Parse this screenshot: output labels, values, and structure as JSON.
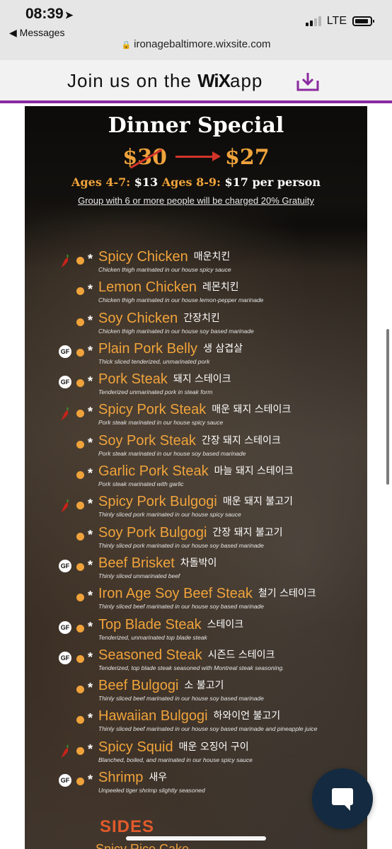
{
  "status_bar": {
    "time": "08:39",
    "location_icon": "location-arrow-icon",
    "back_label": "◀ Messages",
    "network": "LTE"
  },
  "browser": {
    "url": "ironagebaltimore.wixsite.com"
  },
  "wix_banner": {
    "text_before": "Join us on the",
    "logo": "WiX",
    "text_after": "app",
    "accent_color": "#8a29a0"
  },
  "menu": {
    "title": "Dinner Special",
    "old_price": "$30",
    "new_price": "$27",
    "ages_a_label": "Ages 4-7:",
    "ages_a_price": "$13",
    "ages_b_label": "Ages 8-9:",
    "ages_b_price": "$17 per person",
    "gratuity": "Group with 6 or more people will be charged 20% Gratuity",
    "items": [
      {
        "marker": "chili",
        "name": "Spicy Chicken",
        "korean": "매운치킨",
        "desc": "Chicken thigh marinated in our house spicy sauce"
      },
      {
        "marker": "",
        "name": "Lemon Chicken",
        "korean": "레몬치킨",
        "desc": "Chicken thigh marinated in our house lemon-pepper marinade"
      },
      {
        "marker": "",
        "name": "Soy Chicken",
        "korean": "간장치킨",
        "desc": "Chicken thigh marinated in our house soy based marinade"
      },
      {
        "marker": "GF",
        "name": "Plain Pork Belly",
        "korean": "생 삼겹살",
        "desc": "Thick sliced tenderized, unmarinated pork"
      },
      {
        "marker": "GF",
        "name": "Pork Steak",
        "korean": "돼지 스테이크",
        "desc": "Tenderized unmarinated pork in steak form"
      },
      {
        "marker": "chili",
        "name": "Spicy Pork Steak",
        "korean": "매운 돼지 스테이크",
        "desc": "Pork steak marinated in our house spicy sauce"
      },
      {
        "marker": "",
        "name": "Soy Pork Steak",
        "korean": "간장 돼지 스테이크",
        "desc": "Pork steak marinated in our house soy based marinade"
      },
      {
        "marker": "",
        "name": "Garlic Pork Steak",
        "korean": "마늘 돼지 스테이크",
        "desc": "Pork steak marinated with garlic"
      },
      {
        "marker": "chili",
        "name": "Spicy Pork Bulgogi",
        "korean": "매운 돼지 불고기",
        "desc": "Thinly sliced pork marinated in our house spicy sauce"
      },
      {
        "marker": "",
        "name": "Soy Pork Bulgogi",
        "korean": "간장 돼지 불고기",
        "desc": "Thinly sliced pork marinated in our house soy based marinade"
      },
      {
        "marker": "GF",
        "name": "Beef Brisket",
        "korean": "차돌박이",
        "desc": "Thinly sliced unmarinated beef"
      },
      {
        "marker": "",
        "name": "Iron Age Soy Beef Steak",
        "korean": "철기 스테이크",
        "desc": "Thinly sliced beef marinated in our house soy based marinade"
      },
      {
        "marker": "GF",
        "name": "Top Blade Steak",
        "korean": "스테이크",
        "desc": "Tenderized, unmarinated top blade steak"
      },
      {
        "marker": "GF",
        "name": "Seasoned Steak",
        "korean": "시즌드 스테이크",
        "desc": "Tenderized, top blade steak seasoned with Montreal steak seasoning."
      },
      {
        "marker": "",
        "name": "Beef Bulgogi",
        "korean": "소 불고기",
        "desc": "Thinly sliced beef marinated in our house soy based marinade"
      },
      {
        "marker": "",
        "name": "Hawaiian Bulgogi",
        "korean": "하와이언 불고기",
        "desc": "Thinly sliced beef marinated in our house soy based marinade and pineapple juice"
      },
      {
        "marker": "chili",
        "name": "Spicy Squid",
        "korean": "매운 오징어 구이",
        "desc": "Blanched, boiled, and marinated in our house spicy sauce"
      },
      {
        "marker": "GF",
        "name": "Shrimp",
        "korean": "새우",
        "desc": "Unpeeled tiger shrimp slightly seasoned"
      }
    ],
    "sides_heading": "SIDES",
    "next_item_partial": "Spicy Rice Cake"
  },
  "icons": {
    "chat": "chat-bubble-icon",
    "download": "download-icon",
    "lock": "lock-icon",
    "gf_badge_label": "GF"
  },
  "colors": {
    "accent_gold": "#f0a33b",
    "strike_red": "#d2342a",
    "sides_orange": "#e35a2b",
    "chat_button": "#142a40"
  }
}
